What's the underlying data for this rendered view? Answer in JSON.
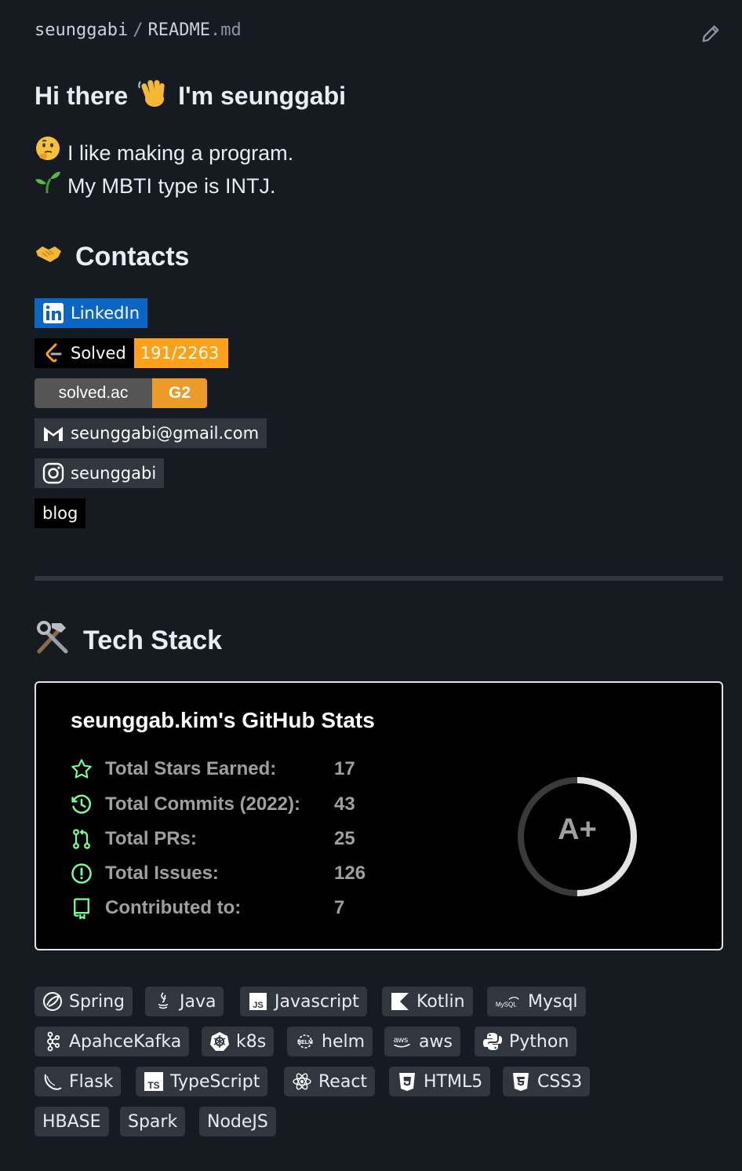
{
  "breadcrumb": {
    "owner": "seunggabi",
    "separator": "/",
    "file_base": "README",
    "file_ext": ".md"
  },
  "intro": {
    "greeting": "Hi there",
    "greeting_suffix": "I'm seunggabi",
    "line1": "I like making a program.",
    "line2": "My MBTI type is INTJ."
  },
  "contacts": {
    "heading": "Contacts",
    "linkedin": "LinkedIn",
    "leetcode_label": "Solved",
    "leetcode_value": "191/2263",
    "solvedac_label": "solved.ac",
    "solvedac_value": "G2",
    "email": "seunggabi@gmail.com",
    "instagram": "seunggabi",
    "blog": "blog"
  },
  "tech": {
    "heading": "Tech Stack"
  },
  "stats": {
    "title": "seunggab.kim's GitHub Stats",
    "rows": [
      {
        "label": "Total Stars Earned:",
        "value": "17",
        "icon": "star-icon"
      },
      {
        "label": "Total Commits (2022):",
        "value": "43",
        "icon": "history-icon"
      },
      {
        "label": "Total PRs:",
        "value": "25",
        "icon": "pull-request-icon"
      },
      {
        "label": "Total Issues:",
        "value": "126",
        "icon": "issue-icon"
      },
      {
        "label": "Contributed to:",
        "value": "7",
        "icon": "repo-icon"
      }
    ],
    "rank": "A+",
    "rank_progress": 0.5
  },
  "skills": [
    "Spring",
    "Java",
    "Javascript",
    "Kotlin",
    "Mysql",
    "ApahceKafka",
    "k8s",
    "helm",
    "aws",
    "Python",
    "Flask",
    "TypeScript",
    "React",
    "HTML5",
    "CSS3",
    "HBASE",
    "Spark",
    "NodeJS"
  ],
  "colors": {
    "background": "#161b22",
    "linkedin": "#0a66c2",
    "leetcode_value_bg": "#ffa116",
    "solvedac_gray": "#555555",
    "solvedac_gold": "#ec9a28",
    "chip_bg": "#31373f",
    "stats_icon": "#79ff97"
  }
}
